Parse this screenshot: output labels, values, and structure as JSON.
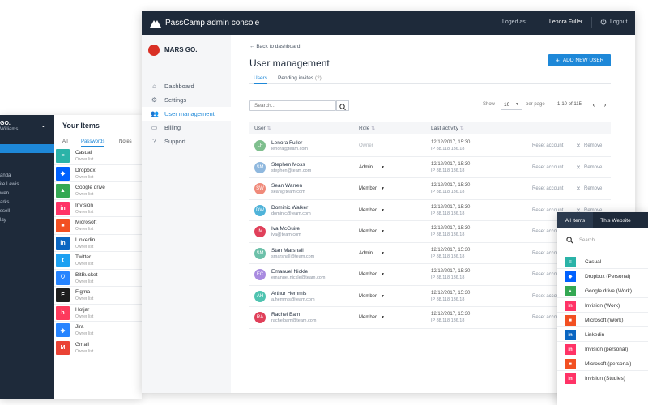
{
  "left_window": {
    "org": "GO.",
    "org_sub": "Williams",
    "nav": [
      "anda",
      "ite Lewis",
      "wen",
      "arks",
      "ssell",
      "lay"
    ],
    "title": "Your Items",
    "tabs": [
      "All",
      "Passwords",
      "Notes"
    ],
    "items": [
      {
        "name": "Casual",
        "sub": "Owner list",
        "icon": "casual-icon",
        "color": "#2bb3a8"
      },
      {
        "name": "Dropbox",
        "sub": "Owner list",
        "icon": "dropbox-icon",
        "color": "#0061fe"
      },
      {
        "name": "Google drive",
        "sub": "Owner list",
        "icon": "google-drive-icon",
        "color": "#34a853"
      },
      {
        "name": "Invision",
        "sub": "Owner list",
        "icon": "invision-icon",
        "color": "#ff3366"
      },
      {
        "name": "Microsoft",
        "sub": "Owner list",
        "icon": "microsoft-icon",
        "color": "#f25022"
      },
      {
        "name": "Linkedin",
        "sub": "Owner list",
        "icon": "linkedin-icon",
        "color": "#0a66c2"
      },
      {
        "name": "Twitter",
        "sub": "Owner list",
        "icon": "twitter-icon",
        "color": "#1da1f2"
      },
      {
        "name": "BitBucket",
        "sub": "Owner list",
        "icon": "bitbucket-icon",
        "color": "#2684ff"
      },
      {
        "name": "Figma",
        "sub": "Owner list",
        "icon": "figma-icon",
        "color": "#1e1e1e"
      },
      {
        "name": "Hotjar",
        "sub": "Owner list",
        "icon": "hotjar-icon",
        "color": "#fd3a5c"
      },
      {
        "name": "Jira",
        "sub": "Owner list",
        "icon": "jira-icon",
        "color": "#2684ff"
      },
      {
        "name": "Gmail",
        "sub": "Owner list",
        "icon": "gmail-icon",
        "color": "#ea4335"
      }
    ]
  },
  "header": {
    "app_title": "PassCamp admin console",
    "logged_as_label": "Loged as:",
    "logged_user": "Lenora Fuller",
    "logout_label": "Logout"
  },
  "sidebar": {
    "brand": "MARS GO.",
    "items": [
      {
        "label": "Dashboard",
        "icon": "home-icon",
        "glyph": "⌂"
      },
      {
        "label": "Settings",
        "icon": "gear-icon",
        "glyph": "⚙"
      },
      {
        "label": "User management",
        "icon": "users-icon",
        "glyph": "👥"
      },
      {
        "label": "Billing",
        "icon": "credit-card-icon",
        "glyph": "▭"
      },
      {
        "label": "Support",
        "icon": "help-icon",
        "glyph": "?"
      }
    ]
  },
  "main": {
    "back_label": "Back to dashboard",
    "page_title": "User management",
    "add_button": "ADD NEW USER",
    "tabs": [
      {
        "label": "Users"
      },
      {
        "label": "Pending invites",
        "count": "(2)"
      }
    ],
    "search_placeholder": "Search...",
    "show_label": "Show",
    "show_value": "10",
    "per_page_label": "per page",
    "range": "1-10 of 115",
    "columns": [
      "User",
      "Role",
      "Last activity"
    ],
    "reset_label": "Reset account",
    "remove_label": "Remove",
    "users": [
      {
        "initials": "LF",
        "name": "Lenora Fuller",
        "email": "lenora@team.com",
        "role": "Owner",
        "date": "12/12/2017, 15:30",
        "ip": "IP 88.118.136.18",
        "color": "#7fbf8e"
      },
      {
        "initials": "SM",
        "name": "Stephen Moss",
        "email": "stephen@team.com",
        "role": "Admin",
        "date": "12/12/2017, 15:30",
        "ip": "IP 88.118.136.18",
        "color": "#8fb8de"
      },
      {
        "initials": "SW",
        "name": "Sean Warren",
        "email": "sean@team.com",
        "role": "Member",
        "date": "12/12/2017, 15:30",
        "ip": "IP 88.118.136.18",
        "color": "#f08a7a"
      },
      {
        "initials": "DW",
        "name": "Dominic Walker",
        "email": "dominic@team.com",
        "role": "Member",
        "date": "12/12/2017, 15:30",
        "ip": "IP 88.118.136.18",
        "color": "#4fb3d9"
      },
      {
        "initials": "IM",
        "name": "Iva McGuire",
        "email": "iva@team.com",
        "role": "Member",
        "date": "12/12/2017, 15:30",
        "ip": "IP 88.118.136.18",
        "color": "#e0405a"
      },
      {
        "initials": "SM",
        "name": "Stan Marshall",
        "email": "smarshall@team.com",
        "role": "Admin",
        "date": "12/12/2017, 15:30",
        "ip": "IP 88.118.136.18",
        "color": "#6cc0a9"
      },
      {
        "initials": "EC",
        "name": "Emanuel Nickle",
        "email": "emanuel.nickle@team.com",
        "role": "Member",
        "date": "12/12/2017, 15:30",
        "ip": "IP 88.118.136.18",
        "color": "#a98be0"
      },
      {
        "initials": "AH",
        "name": "Arthur Hemmis",
        "email": "a.hemmis@team.com",
        "role": "Member",
        "date": "12/12/2017, 15:30",
        "ip": "IP 88.118.136.18",
        "color": "#4fc3b0"
      },
      {
        "initials": "RA",
        "name": "Rachel Bam",
        "email": "rachelbam@team.com",
        "role": "Member",
        "date": "12/12/2017, 15:30",
        "ip": "IP 88.118.136.18",
        "color": "#e0405a"
      }
    ]
  },
  "popup": {
    "tabs": [
      "All items",
      "This Website"
    ],
    "search_placeholder": "Search",
    "items": [
      {
        "name": "Casual",
        "icon": "casual-icon",
        "color": "#2bb3a8"
      },
      {
        "name": "Dropbox (Personal)",
        "icon": "dropbox-icon",
        "color": "#0061fe"
      },
      {
        "name": "Google drive (Work)",
        "icon": "google-drive-icon",
        "color": "#34a853"
      },
      {
        "name": "Invision (Work)",
        "icon": "invision-icon",
        "color": "#ff3366"
      },
      {
        "name": "Microsoft (Work)",
        "icon": "microsoft-icon",
        "color": "#f25022"
      },
      {
        "name": "Linkedin",
        "icon": "linkedin-icon",
        "color": "#0a66c2"
      },
      {
        "name": "Invision (personal)",
        "icon": "invision-icon",
        "color": "#ff3366"
      },
      {
        "name": "Microsoft (personal)",
        "icon": "microsoft-icon",
        "color": "#f25022"
      },
      {
        "name": "Invision (Studies)",
        "icon": "invision-icon",
        "color": "#ff3366"
      }
    ]
  },
  "colors": {
    "accent": "#1e88d8",
    "header": "#1e2a3a",
    "brand_red": "#d93025"
  }
}
